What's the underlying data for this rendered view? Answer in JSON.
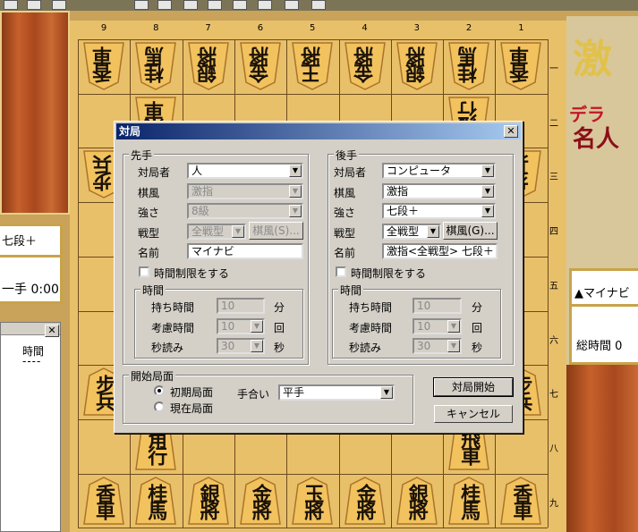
{
  "board": {
    "files": [
      "9",
      "8",
      "7",
      "6",
      "5",
      "4",
      "3",
      "2",
      "1"
    ],
    "ranks": [
      "一",
      "二",
      "三",
      "四",
      "五",
      "六",
      "七",
      "八",
      "九"
    ],
    "pieces": [
      {
        "ch": "香車",
        "col": 0,
        "row": 0,
        "gote": true
      },
      {
        "ch": "桂馬",
        "col": 1,
        "row": 0,
        "gote": true
      },
      {
        "ch": "銀將",
        "col": 2,
        "row": 0,
        "gote": true
      },
      {
        "ch": "金將",
        "col": 3,
        "row": 0,
        "gote": true
      },
      {
        "ch": "王將",
        "col": 4,
        "row": 0,
        "gote": true
      },
      {
        "ch": "金將",
        "col": 5,
        "row": 0,
        "gote": true
      },
      {
        "ch": "銀將",
        "col": 6,
        "row": 0,
        "gote": true
      },
      {
        "ch": "桂馬",
        "col": 7,
        "row": 0,
        "gote": true
      },
      {
        "ch": "香車",
        "col": 8,
        "row": 0,
        "gote": true
      },
      {
        "ch": "飛車",
        "col": 1,
        "row": 1,
        "gote": true
      },
      {
        "ch": "角行",
        "col": 7,
        "row": 1,
        "gote": true
      },
      {
        "ch": "步兵",
        "col": 0,
        "row": 2,
        "gote": true
      },
      {
        "ch": "步兵",
        "col": 8,
        "row": 2,
        "gote": true
      },
      {
        "ch": "步兵",
        "col": 0,
        "row": 6,
        "gote": false
      },
      {
        "ch": "步兵",
        "col": 8,
        "row": 6,
        "gote": false
      },
      {
        "ch": "角行",
        "col": 1,
        "row": 7,
        "gote": false
      },
      {
        "ch": "飛車",
        "col": 7,
        "row": 7,
        "gote": false
      },
      {
        "ch": "香車",
        "col": 0,
        "row": 8,
        "gote": false
      },
      {
        "ch": "桂馬",
        "col": 1,
        "row": 8,
        "gote": false
      },
      {
        "ch": "銀將",
        "col": 2,
        "row": 8,
        "gote": false
      },
      {
        "ch": "金將",
        "col": 3,
        "row": 8,
        "gote": false
      },
      {
        "ch": "玉將",
        "col": 4,
        "row": 8,
        "gote": false
      },
      {
        "ch": "金將",
        "col": 5,
        "row": 8,
        "gote": false
      },
      {
        "ch": "銀將",
        "col": 6,
        "row": 8,
        "gote": false
      },
      {
        "ch": "桂馬",
        "col": 7,
        "row": 8,
        "gote": false
      },
      {
        "ch": "香車",
        "col": 8,
        "row": 8,
        "gote": false
      }
    ]
  },
  "left": {
    "opponent_partial": "七段＋",
    "time_partial": "一手 0:00",
    "list_header": "時間",
    "list_row": "----"
  },
  "right": {
    "title": "激",
    "sub1": "デラ",
    "sub2": "名人",
    "player": "▲マイナビ",
    "time": "総時間 0"
  },
  "dialog": {
    "title": "対局",
    "close": "✕",
    "sente": {
      "group": "先手",
      "player_label": "対局者",
      "player": "人",
      "style_label": "棋風",
      "style": "激指",
      "strength_label": "強さ",
      "strength": "8級",
      "senkei_label": "戦型",
      "senkei": "全戦型",
      "kifu_btn": "棋風(S)...",
      "name_label": "名前",
      "name": "マイナビ",
      "timelimit": "時間制限をする",
      "time_group": "時間",
      "mochi_label": "持ち時間",
      "mochi": "10",
      "mochi_unit": "分",
      "kouryo_label": "考慮時間",
      "kouryo": "10",
      "kouryo_unit": "回",
      "byo_label": "秒読み",
      "byo": "30",
      "byo_unit": "秒"
    },
    "gote": {
      "group": "後手",
      "player_label": "対局者",
      "player": "コンピュータ",
      "style_label": "棋風",
      "style": "激指",
      "strength_label": "強さ",
      "strength": "七段＋",
      "senkei_label": "戦型",
      "senkei": "全戦型",
      "kifu_btn": "棋風(G)...",
      "name_label": "名前",
      "name": "激指<全戦型> 七段＋",
      "timelimit": "時間制限をする",
      "time_group": "時間",
      "mochi_label": "持ち時間",
      "mochi": "10",
      "mochi_unit": "分",
      "kouryo_label": "考慮時間",
      "kouryo": "10",
      "kouryo_unit": "回",
      "byo_label": "秒読み",
      "byo": "30",
      "byo_unit": "秒"
    },
    "start": {
      "group": "開始局面",
      "initial": "初期局面",
      "current": "現在局面",
      "handicap_label": "手合い",
      "handicap": "平手"
    },
    "start_btn": "対局開始",
    "cancel_btn": "キャンセル"
  }
}
